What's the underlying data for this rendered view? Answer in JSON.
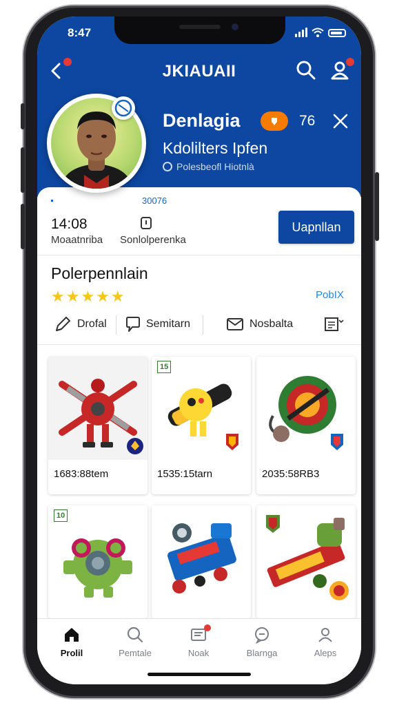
{
  "status_bar": {
    "time": "8:47"
  },
  "header": {
    "title": "JKIAUAII"
  },
  "profile": {
    "name": "Denlagia",
    "level": "76",
    "subtitle": "Kdolilters Ipfen",
    "handle": "Polesbeofl Hiotnlà",
    "code": "30076"
  },
  "stats": [
    {
      "value": "14:08",
      "label": "Moaatnriba"
    },
    {
      "value": "",
      "label": "Sonlolperenka"
    }
  ],
  "primary_button": {
    "label": "Uapnllan"
  },
  "section": {
    "title": "Polerpennlain",
    "rating": 5,
    "stars": "★★★★★",
    "link": "PobIX"
  },
  "actions": [
    {
      "label": "Drofal",
      "icon": "pen-icon"
    },
    {
      "label": "Semitarn",
      "icon": "chat-bubble-icon"
    },
    {
      "label": "Nosbalta",
      "icon": "mail-icon"
    },
    {
      "label": "",
      "icon": "list-dropdown-icon"
    }
  ],
  "products": [
    {
      "caption": "1683:88tem",
      "tag": ""
    },
    {
      "caption": "1535:15tarn",
      "tag": "15"
    },
    {
      "caption": "2035:58RB3",
      "tag": ""
    },
    {
      "caption": "",
      "tag": "10"
    },
    {
      "caption": "",
      "tag": ""
    },
    {
      "caption": "",
      "tag": ""
    }
  ],
  "tabs": [
    {
      "label": "Prolil",
      "icon": "home-icon",
      "active": true,
      "badge": false
    },
    {
      "label": "Pemtale",
      "icon": "search-icon",
      "active": false,
      "badge": false
    },
    {
      "label": "Noak",
      "icon": "messages-icon",
      "active": false,
      "badge": true
    },
    {
      "label": "Blarnga",
      "icon": "chat-icon",
      "active": false,
      "badge": false
    },
    {
      "label": "Aleps",
      "icon": "person-icon",
      "active": false,
      "badge": false
    }
  ],
  "colors": {
    "brand_blue": "#0d47a1",
    "accent_orange": "#f57c00",
    "star_yellow": "#f5c518",
    "link_blue": "#1e88e5",
    "notification_red": "#e53935"
  }
}
